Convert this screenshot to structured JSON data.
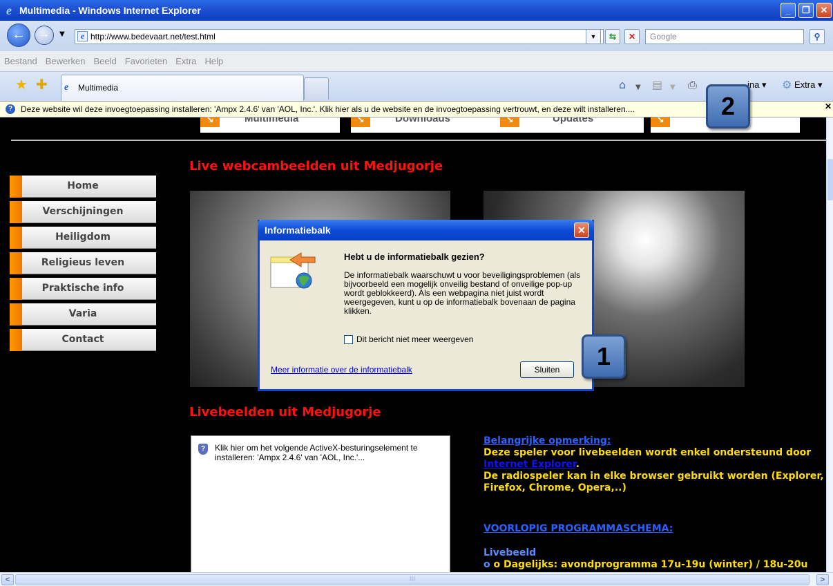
{
  "window": {
    "title": "Multimedia - Windows Internet Explorer"
  },
  "address": {
    "url": "http://www.bedevaart.net/test.html",
    "search_placeholder": "Google"
  },
  "menu": [
    "Bestand",
    "Bewerken",
    "Beeld",
    "Favorieten",
    "Extra",
    "Help"
  ],
  "tabs": {
    "active_title": "Multimedia"
  },
  "toolbar": {
    "page_label": "ina ▾",
    "extra_label": "Extra ▾"
  },
  "infobar": {
    "text": "Deze website wil deze invoegtoepassing installeren: 'Ampx 2.4.6' van 'AOL, Inc.'. Klik hier als u de website en de invoegtoepassing vertrouwt, en deze wilt installeren...."
  },
  "topnav": [
    "Multimedia",
    "Downloads",
    "Updates"
  ],
  "sections": {
    "webcam_title": "Live webcambeelden uit Medjugorje",
    "live_title": "Livebeelden uit Medjugorje"
  },
  "sidebar": [
    "Home",
    "Verschijningen",
    "Heiligdom",
    "Religieus leven",
    "Praktische info",
    "Varia",
    "Contact"
  ],
  "activex": {
    "text": "Klik hier om het volgende ActiveX-besturingselement te installeren: 'Ampx 2.4.6' van 'AOL, Inc.'..."
  },
  "note": {
    "heading": "Belangrijke opmerking:",
    "line1": "Deze speler voor livebeelden wordt enkel ondersteund door",
    "ie_link": "Internet Explorer",
    "line2": "De radiospeler kan in elke browser gebruikt worden (Explorer, Firefox, Chrome, Opera,..)",
    "schedule_link": "VOORLOPIG PROGRAMMASCHEMA:",
    "schedule_sub": "Livebeeld",
    "schedule_line": "o Dagelijks: avondprogramma 17u-19u (winter) / 18u-20u"
  },
  "dialog": {
    "title": "Informatiebalk",
    "heading": "Hebt u de informatiebalk gezien?",
    "body": "De informatiebalk waarschuwt u voor beveiligingsproblemen (als bijvoorbeeld een mogelijk onveilig bestand of onveilige pop-up wordt geblokkeerd). Als een webpagina niet juist wordt weergegeven, kunt u op de informatiebalk bovenaan de pagina klikken.",
    "checkbox": "Dit bericht niet meer weergeven",
    "more_link": "Meer informatie over de informatiebalk",
    "close_button": "Sluiten"
  },
  "badges": {
    "one": "1",
    "two": "2"
  },
  "icons": [
    "ie-logo-icon",
    "back-arrow-icon",
    "forward-arrow-icon",
    "refresh-icon",
    "stop-icon",
    "search-icon",
    "star-icon",
    "add-favorite-icon",
    "home-icon",
    "feed-icon",
    "print-icon",
    "page-icon",
    "gear-icon",
    "shield-icon",
    "close-icon",
    "globe-icon"
  ]
}
